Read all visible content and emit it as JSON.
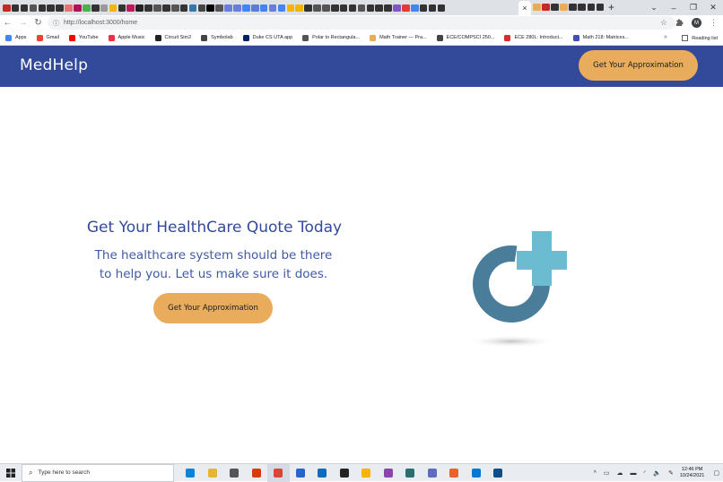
{
  "browser": {
    "tab_favicon_colors": [
      "#c62828",
      "#333333",
      "#333333",
      "#555555",
      "#333333",
      "#333333",
      "#333333",
      "#e57373",
      "#ad1457",
      "#4caf50",
      "#333333",
      "#999999",
      "#f4b400",
      "#333333",
      "#c2185b",
      "#222222",
      "#333333",
      "#555555",
      "#333333",
      "#555555",
      "#333333",
      "#3776ab",
      "#444444",
      "#000000",
      "#555555",
      "#6b7ddb",
      "#6b7ddb",
      "#4285f4",
      "#5c7cd6",
      "#4285f4",
      "#6b7ddb",
      "#4285f4",
      "#f4b400",
      "#f4b400",
      "#333333",
      "#555555",
      "#555555",
      "#333333",
      "#333333",
      "#333333",
      "#555555",
      "#333333",
      "#333333",
      "#333333",
      "#7e57c2",
      "#e53935",
      "#4285f4",
      "#333333",
      "#333333",
      "#333333"
    ],
    "tab_close_glyph": "×",
    "tab_after_colors": [
      "#e8ac5c",
      "#c62828",
      "#333333",
      "#e8ac5c",
      "#333333",
      "#333333",
      "#333333",
      "#333333"
    ],
    "new_tab_glyph": "+",
    "window_controls": [
      "⌄",
      "–",
      "❐",
      "✕"
    ],
    "nav": {
      "back": "←",
      "forward": "→",
      "reload": "↻"
    },
    "url": "http://localhost:3000/home",
    "url_icon": "info-icon",
    "omnibox_right": {
      "star": "☆",
      "extensions": "puzzle-icon",
      "profile_initial": "M",
      "menu": "⋮"
    },
    "bookmarks": [
      {
        "label": "Apps",
        "color": "#4285f4"
      },
      {
        "label": "Gmail",
        "color": "#ea4335"
      },
      {
        "label": "YouTube",
        "color": "#ff0000"
      },
      {
        "label": "Apple Music",
        "color": "#fa2d48"
      },
      {
        "label": "Circuit Sim2",
        "color": "#222222"
      },
      {
        "label": "Symbolab",
        "color": "#444444"
      },
      {
        "label": "Duke CS UTA app",
        "color": "#012169"
      },
      {
        "label": "Polar to Rectangula...",
        "color": "#555555"
      },
      {
        "label": "Math Trainer — Pra...",
        "color": "#e8ac5c"
      },
      {
        "label": "ECE/COMPSCI 250...",
        "color": "#444444"
      },
      {
        "label": "ECE 280L: Introduct...",
        "color": "#d32f2f"
      },
      {
        "label": "Math 218: Matrices...",
        "color": "#3f51b5"
      }
    ],
    "bookmarks_more": "»",
    "reading_list": "Reading list"
  },
  "app": {
    "brand": "MedHelp",
    "header_cta": "Get Your Approximation",
    "hero": {
      "title": "Get Your HealthCare Quote Today",
      "subtitle_line1": "The healthcare system should be there",
      "subtitle_line2": "to help you. Let us make sure it does.",
      "cta": "Get Your Approximation"
    },
    "colors": {
      "header_bg": "#334a9a",
      "cta_bg": "#e8ac5c",
      "logo_ring": "#4a7d99",
      "logo_cross": "#6bbcd1"
    }
  },
  "taskbar": {
    "search_placeholder": "Type here to search",
    "apps": [
      {
        "name": "edge",
        "color": "#0b84d8"
      },
      {
        "name": "file-explorer",
        "color": "#e8b532"
      },
      {
        "name": "store",
        "color": "#555555"
      },
      {
        "name": "office",
        "color": "#d83b01"
      },
      {
        "name": "chrome",
        "color": "#db4437",
        "active": true
      },
      {
        "name": "todo",
        "color": "#2564cf"
      },
      {
        "name": "mail",
        "color": "#0f6cbd"
      },
      {
        "name": "terminal",
        "color": "#222222"
      },
      {
        "name": "app-diamond",
        "color": "#f4b400"
      },
      {
        "name": "app-circles",
        "color": "#8e44ad"
      },
      {
        "name": "app-ring",
        "color": "#2a6f6f"
      },
      {
        "name": "app-chart",
        "color": "#5c6bc0"
      },
      {
        "name": "app-orange",
        "color": "#e8622c"
      },
      {
        "name": "vscode",
        "color": "#0078d4"
      },
      {
        "name": "app-tower",
        "color": "#0e4e8a"
      }
    ],
    "tray_icons": [
      "^",
      "▭",
      "☁",
      "▬",
      "◜",
      "🔈",
      "✎"
    ],
    "time": "12:46 PM",
    "date": "10/24/2021"
  }
}
